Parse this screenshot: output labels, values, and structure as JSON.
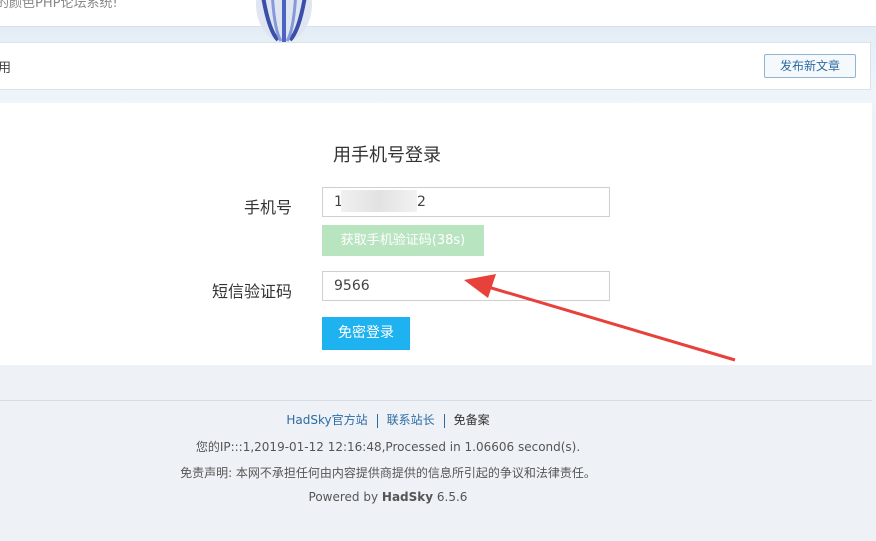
{
  "header": {
    "slogan": "的颜色PHP论坛系统!",
    "nav_text": "用",
    "publish_button": "发布新文章"
  },
  "login": {
    "title": "用手机号登录",
    "phone_label": "手机号",
    "phone_value_start": "1",
    "phone_value_end": "2",
    "sms_button": "获取手机验证码(38s)",
    "code_label": "短信验证码",
    "code_value": "9566",
    "login_button": "免密登录"
  },
  "footer": {
    "links": [
      "HadSky官方站",
      "联系站长"
    ],
    "beian": "免备案",
    "ip_info": "您的IP:::1,2019-01-12 12:16:48,Processed in 1.06606 second(s).",
    "disclaimer": "免责声明: 本网不承担任何由内容提供商提供的信息所引起的争议和法律责任。",
    "powered_prefix": "Powered by ",
    "powered_brand": "HadSky",
    "powered_version": " 6.5.6"
  },
  "colors": {
    "accent_blue": "#1eb3f0",
    "sms_disabled_green": "#b9e4c0",
    "annotation_red": "#e8403a",
    "link_blue": "#2d6aa2"
  }
}
